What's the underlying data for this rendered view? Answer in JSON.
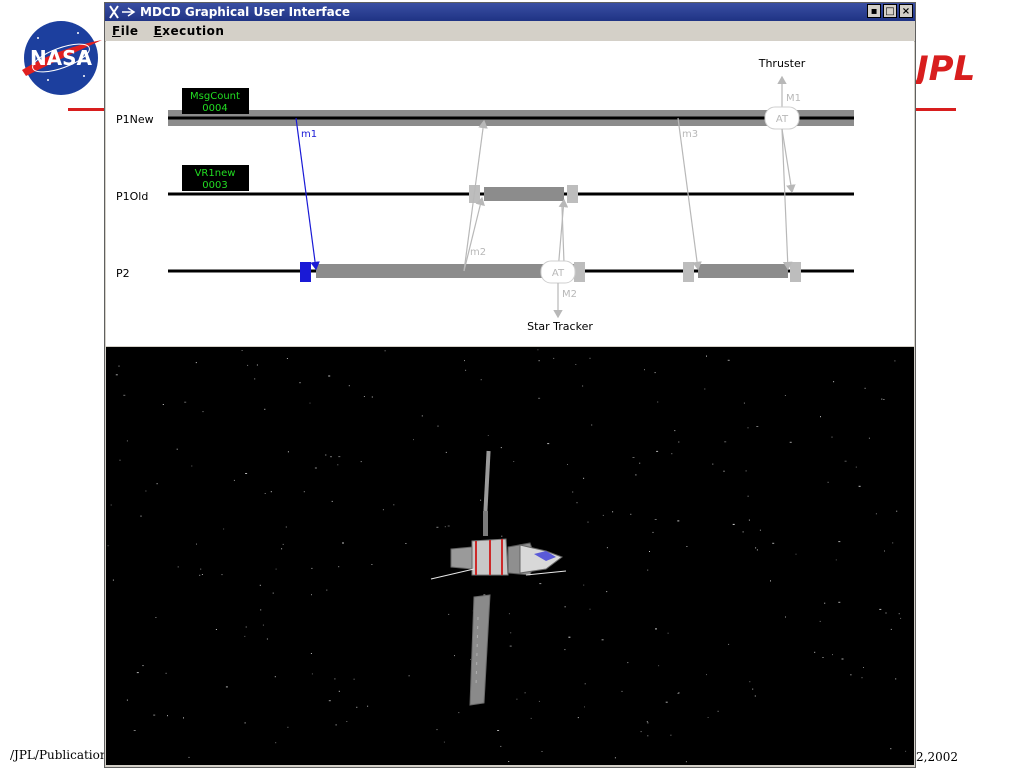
{
  "window": {
    "title": "MDCD Graphical User Interface",
    "controls": {
      "minimize": "▪",
      "maximize": "□",
      "close": "×"
    }
  },
  "menubar": {
    "file": {
      "mnemonic": "F",
      "rest": "ile"
    },
    "execution": {
      "mnemonic": "E",
      "rest": "xecution"
    }
  },
  "timeline": {
    "processes": [
      "P1New",
      "P1Old",
      "P2"
    ],
    "counters": [
      {
        "label": "MsgCount",
        "value": "0004"
      },
      {
        "label": "VR1new",
        "value": "0003"
      }
    ],
    "messages": [
      "m1",
      "m2",
      "m3"
    ],
    "external_events": [
      {
        "node": "AT",
        "tag": "M1",
        "device": "Thruster"
      },
      {
        "node": "AT",
        "tag": "M2",
        "device": "Star Tracker"
      }
    ],
    "colors": {
      "message_active": "#1a1ad6",
      "message_past": "#b8b8b8",
      "counter_bg": "#000000",
      "counter_text": "#22dd22"
    }
  },
  "slide": {
    "footer_left": "/JPL/Publications/",
    "footer_right": "2,2002",
    "left_logo": "NASA",
    "right_logo": "JPL",
    "accent": "#d81e1e"
  },
  "scene": {
    "background": "#000000",
    "icon": "spacecraft-icon"
  }
}
